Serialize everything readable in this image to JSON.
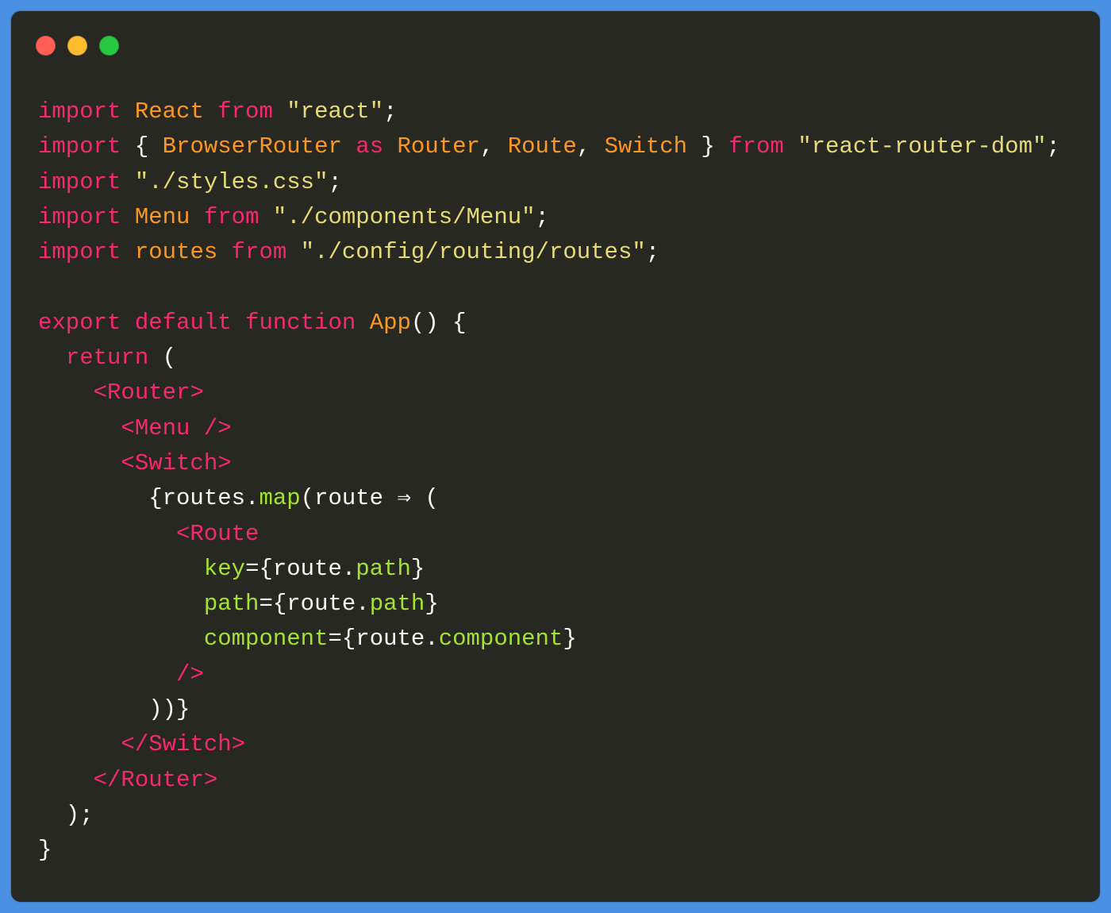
{
  "window": {
    "controls": [
      {
        "name": "close",
        "color": "#ff5f57"
      },
      {
        "name": "minimize",
        "color": "#febc2e"
      },
      {
        "name": "maximize",
        "color": "#28c840"
      }
    ]
  },
  "theme": {
    "background": "#4a90e2",
    "editor_background": "#272822",
    "keyword": "#f92672",
    "identifier": "#fd971f",
    "string": "#e6db74",
    "attribute": "#a6e22e",
    "plain": "#f8f8f2"
  },
  "code": {
    "lines": [
      [
        [
          "kw",
          "import"
        ],
        [
          "plain",
          " "
        ],
        [
          "id",
          "React"
        ],
        [
          "plain",
          " "
        ],
        [
          "kw",
          "from"
        ],
        [
          "plain",
          " "
        ],
        [
          "str",
          "\"react\""
        ],
        [
          "plain",
          ";"
        ]
      ],
      [
        [
          "kw",
          "import"
        ],
        [
          "plain",
          " { "
        ],
        [
          "id",
          "BrowserRouter"
        ],
        [
          "plain",
          " "
        ],
        [
          "kw",
          "as"
        ],
        [
          "plain",
          " "
        ],
        [
          "id",
          "Router"
        ],
        [
          "plain",
          ", "
        ],
        [
          "id",
          "Route"
        ],
        [
          "plain",
          ", "
        ],
        [
          "id",
          "Switch"
        ],
        [
          "plain",
          " } "
        ],
        [
          "kw",
          "from"
        ],
        [
          "plain",
          " "
        ],
        [
          "str",
          "\"react-router-dom\""
        ],
        [
          "plain",
          ";"
        ]
      ],
      [
        [
          "kw",
          "import"
        ],
        [
          "plain",
          " "
        ],
        [
          "str",
          "\"./styles.css\""
        ],
        [
          "plain",
          ";"
        ]
      ],
      [
        [
          "kw",
          "import"
        ],
        [
          "plain",
          " "
        ],
        [
          "id",
          "Menu"
        ],
        [
          "plain",
          " "
        ],
        [
          "kw",
          "from"
        ],
        [
          "plain",
          " "
        ],
        [
          "str",
          "\"./components/Menu\""
        ],
        [
          "plain",
          ";"
        ]
      ],
      [
        [
          "kw",
          "import"
        ],
        [
          "plain",
          " "
        ],
        [
          "id",
          "routes"
        ],
        [
          "plain",
          " "
        ],
        [
          "kw",
          "from"
        ],
        [
          "plain",
          " "
        ],
        [
          "str",
          "\"./config/routing/routes\""
        ],
        [
          "plain",
          ";"
        ]
      ],
      [],
      [
        [
          "kw",
          "export"
        ],
        [
          "plain",
          " "
        ],
        [
          "kw",
          "default"
        ],
        [
          "plain",
          " "
        ],
        [
          "kw",
          "function"
        ],
        [
          "plain",
          " "
        ],
        [
          "id",
          "App"
        ],
        [
          "plain",
          "() {"
        ]
      ],
      [
        [
          "plain",
          "  "
        ],
        [
          "kw",
          "return"
        ],
        [
          "plain",
          " ("
        ]
      ],
      [
        [
          "plain",
          "    "
        ],
        [
          "tag",
          "<Router>"
        ]
      ],
      [
        [
          "plain",
          "      "
        ],
        [
          "tag",
          "<Menu />"
        ]
      ],
      [
        [
          "plain",
          "      "
        ],
        [
          "tag",
          "<Switch>"
        ]
      ],
      [
        [
          "plain",
          "        {routes."
        ],
        [
          "attr",
          "map"
        ],
        [
          "plain",
          "(route ⇒ ("
        ]
      ],
      [
        [
          "plain",
          "          "
        ],
        [
          "tag",
          "<Route"
        ]
      ],
      [
        [
          "plain",
          "            "
        ],
        [
          "attr",
          "key"
        ],
        [
          "plain",
          "={route."
        ],
        [
          "attr",
          "path"
        ],
        [
          "plain",
          "}"
        ]
      ],
      [
        [
          "plain",
          "            "
        ],
        [
          "attr",
          "path"
        ],
        [
          "plain",
          "={route."
        ],
        [
          "attr",
          "path"
        ],
        [
          "plain",
          "}"
        ]
      ],
      [
        [
          "plain",
          "            "
        ],
        [
          "attr",
          "component"
        ],
        [
          "plain",
          "={route."
        ],
        [
          "attr",
          "component"
        ],
        [
          "plain",
          "}"
        ]
      ],
      [
        [
          "plain",
          "          "
        ],
        [
          "tag",
          "/>"
        ]
      ],
      [
        [
          "plain",
          "        ))}"
        ]
      ],
      [
        [
          "plain",
          "      "
        ],
        [
          "tag",
          "</Switch>"
        ]
      ],
      [
        [
          "plain",
          "    "
        ],
        [
          "tag",
          "</Router>"
        ]
      ],
      [
        [
          "plain",
          "  );"
        ]
      ],
      [
        [
          "plain",
          "}"
        ]
      ]
    ]
  }
}
